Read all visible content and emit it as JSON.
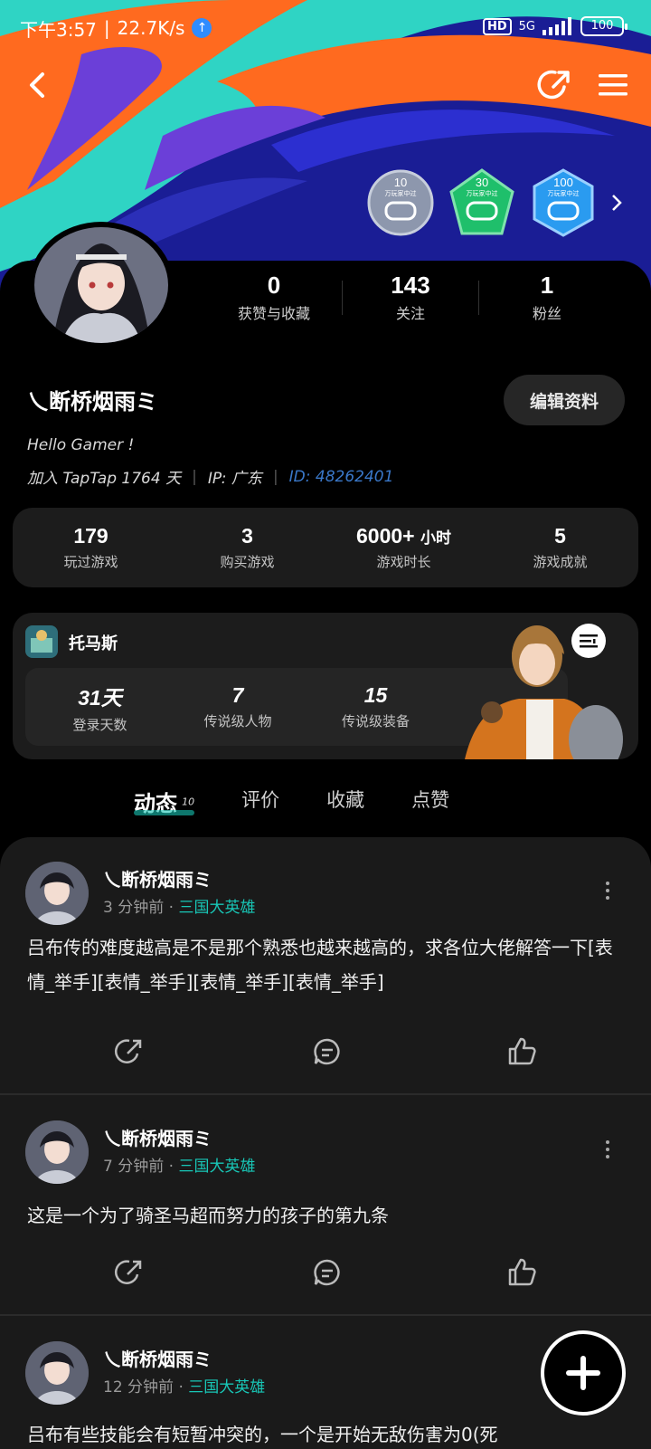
{
  "status": {
    "time": "下午3:57",
    "speed": "22.7K/s",
    "battery": "100",
    "network": "5G"
  },
  "profile": {
    "name": "乀断桥烟雨ミ",
    "stats": [
      {
        "num": "0",
        "label": "获赞与收藏"
      },
      {
        "num": "143",
        "label": "关注"
      },
      {
        "num": "1",
        "label": "粉丝"
      }
    ],
    "edit_label": "编辑资料",
    "bio": "Hello Gamer !",
    "join": "加入 TapTap 1764 天",
    "ip": "IP: 广东",
    "id": "ID: 48262401",
    "badges": [
      {
        "top": "10",
        "sub": "万玩家中过",
        "color": "#9aa3b8"
      },
      {
        "top": "30",
        "sub": "万玩家中过",
        "color": "#1fbf6b"
      },
      {
        "top": "100",
        "sub": "万玩家中过",
        "color": "#2a9bf0"
      }
    ]
  },
  "game_stats": [
    {
      "num": "179",
      "label": "玩过游戏"
    },
    {
      "num": "3",
      "label": "购买游戏"
    },
    {
      "num": "6000+",
      "unit": "小时",
      "label": "游戏时长"
    },
    {
      "num": "5",
      "label": "游戏成就"
    }
  ],
  "game_card": {
    "title": "托马斯",
    "stats": [
      {
        "num": "31天",
        "label": "登录天数"
      },
      {
        "num": "7",
        "label": "传说级人物"
      },
      {
        "num": "15",
        "label": "传说级装备"
      }
    ]
  },
  "tabs": [
    {
      "label": "动态",
      "count": "10"
    },
    {
      "label": "评价"
    },
    {
      "label": "收藏"
    },
    {
      "label": "点赞"
    }
  ],
  "posts": [
    {
      "author": "乀断桥烟雨ミ",
      "time": "3 分钟前",
      "tag": "三国大英雄",
      "text": "吕布传的难度越高是不是那个熟悉也越来越高的，求各位大佬解答一下[表情_举手][表情_举手][表情_举手][表情_举手]"
    },
    {
      "author": "乀断桥烟雨ミ",
      "time": "7 分钟前",
      "tag": "三国大英雄",
      "text": "这是一个为了骑圣马超而努力的孩子的第九条"
    },
    {
      "author": "乀断桥烟雨ミ",
      "time": "12 分钟前",
      "tag": "三国大英雄",
      "text": "吕布有些技能会有短暂冲突的，一个是开始无敌伤害为0(死"
    }
  ],
  "icons": {
    "back": "back-arrow-icon",
    "share": "share-icon",
    "menu": "menu-icon",
    "fab": "plus-icon"
  },
  "colors": {
    "accent": "#18c6b6",
    "id": "#3a78c9",
    "background": "#000000",
    "card": "#1c1c1c"
  }
}
